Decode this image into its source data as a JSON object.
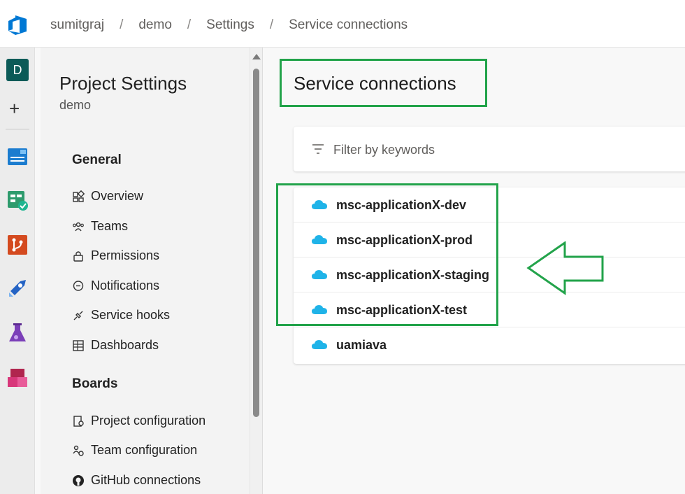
{
  "breadcrumb": [
    "sumitgraj",
    "demo",
    "Settings",
    "Service connections"
  ],
  "breadcrumb_separator": "/",
  "rail": {
    "avatar_letter": "D",
    "icons": [
      "overview-icon",
      "boards-icon",
      "repos-icon",
      "pipelines-icon",
      "test-plans-icon",
      "artifacts-icon"
    ]
  },
  "sidebar": {
    "title": "Project Settings",
    "subtitle": "demo",
    "general_heading": "General",
    "general_items": [
      "Overview",
      "Teams",
      "Permissions",
      "Notifications",
      "Service hooks",
      "Dashboards"
    ],
    "boards_heading": "Boards",
    "boards_items": [
      "Project configuration",
      "Team configuration",
      "GitHub connections"
    ]
  },
  "main": {
    "title": "Service connections",
    "filter_placeholder": "Filter by keywords",
    "connections": [
      "msc-applicationX-dev",
      "msc-applicationX-prod",
      "msc-applicationX-staging",
      "msc-applicationX-test",
      "uamiava"
    ]
  },
  "colors": {
    "accent": "#0078d4",
    "highlight": "#22a34a",
    "cloud": "#1fb3e8"
  }
}
